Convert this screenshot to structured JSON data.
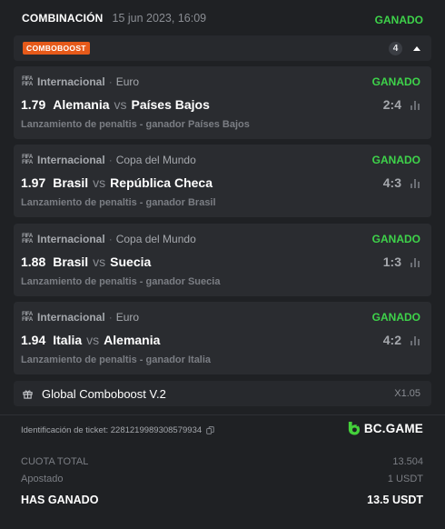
{
  "header": {
    "type_label": "COMBINACIÓN",
    "date": "15 jun 2023, 16:09",
    "status": "GANADO"
  },
  "combo": {
    "badge": "COMBOBOOST",
    "count": "4"
  },
  "selections": [
    {
      "league": "Internacional",
      "category": "Euro",
      "status": "GANADO",
      "odds": "1.79",
      "home": "Alemania",
      "vs": "vs",
      "away": "Países Bajos",
      "score": "2:4",
      "market": "Lanzamiento de penaltis - ganador Países Bajos"
    },
    {
      "league": "Internacional",
      "category": "Copa del Mundo",
      "status": "GANADO",
      "odds": "1.97",
      "home": "Brasil",
      "vs": "vs",
      "away": "República Checa",
      "score": "4:3",
      "market": "Lanzamiento de penaltis - ganador Brasil"
    },
    {
      "league": "Internacional",
      "category": "Copa del Mundo",
      "status": "GANADO",
      "odds": "1.88",
      "home": "Brasil",
      "vs": "vs",
      "away": "Suecia",
      "score": "1:3",
      "market": "Lanzamiento de penaltis - ganador Suecia"
    },
    {
      "league": "Internacional",
      "category": "Euro",
      "status": "GANADO",
      "odds": "1.94",
      "home": "Italia",
      "vs": "vs",
      "away": "Alemania",
      "score": "4:2",
      "market": "Lanzamiento de penaltis - ganador Italia"
    }
  ],
  "global_boost": {
    "label": "Global Comboboost V.2",
    "multiplier": "X1.05"
  },
  "ticket": {
    "id_label": "Identificación de ticket: 2281219989308579934"
  },
  "brand": {
    "name": "BC.GAME"
  },
  "summary": {
    "total_odds_label": "CUOTA TOTAL",
    "total_odds_value": "13.504",
    "stake_label": "Apostado",
    "stake_value": "1 USDT",
    "won_label": "HAS GANADO",
    "won_value": "13.5 USDT"
  },
  "icons": {
    "fifa": "fifa-logo-icon",
    "stats": "bar-chart-icon",
    "gift": "gift-icon",
    "copy": "copy-icon",
    "caret": "caret-up-icon",
    "brand": "bc-game-logo-icon"
  },
  "colors": {
    "background": "#1f2124",
    "card": "#2a2c30",
    "won_green": "#3ed34a",
    "boost_orange": "#e65a1a",
    "brand_green": "#44d13b"
  }
}
